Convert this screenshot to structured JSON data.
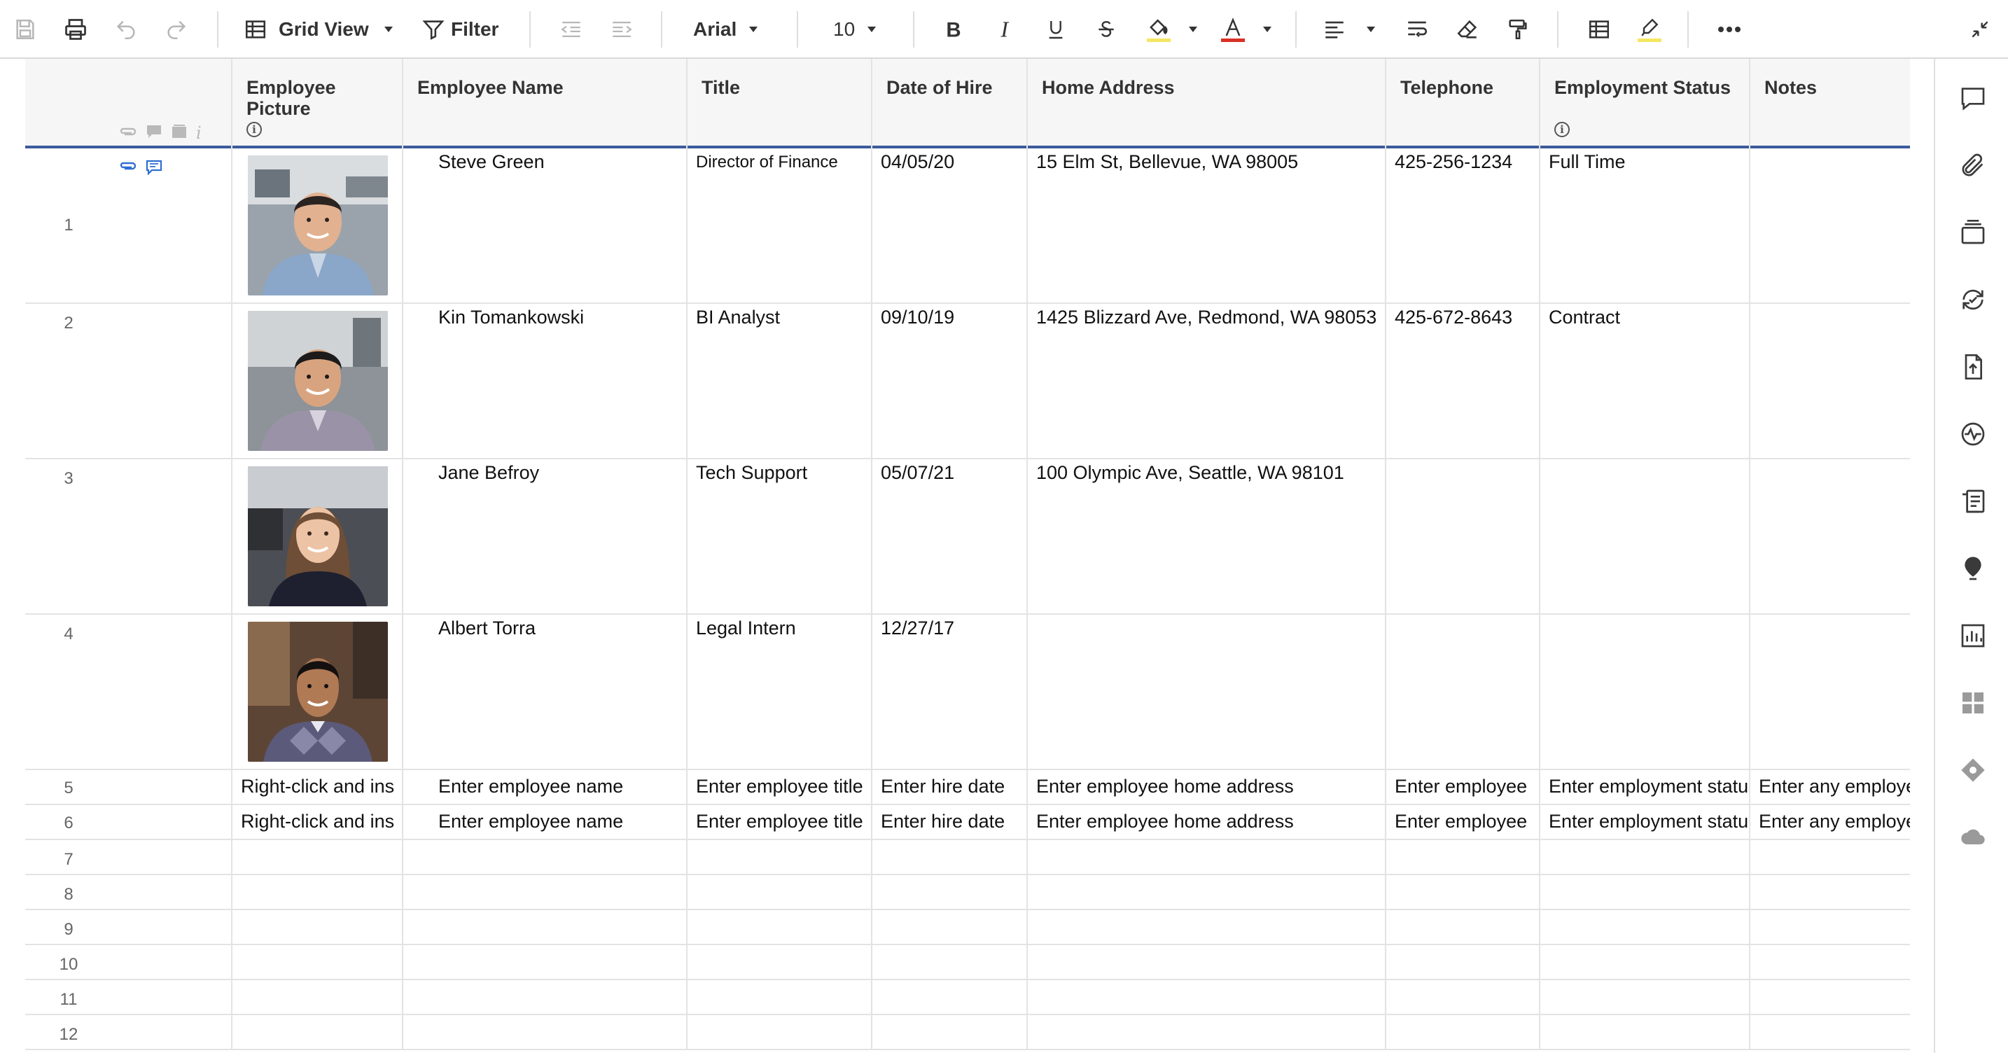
{
  "toolbar": {
    "view_label": "Grid View",
    "filter_label": "Filter",
    "font_family": "Arial",
    "font_size": "10"
  },
  "columns": [
    {
      "label": "Employee Picture"
    },
    {
      "label": "Employee Name"
    },
    {
      "label": "Title"
    },
    {
      "label": "Date of Hire"
    },
    {
      "label": "Home Address"
    },
    {
      "label": "Telephone"
    },
    {
      "label": "Employment Status"
    },
    {
      "label": "Notes"
    }
  ],
  "rows": [
    {
      "num": "1",
      "picture": "person-photo",
      "name": "Steve Green",
      "title": "Director of Finance",
      "hire": "04/05/20",
      "address": "15 Elm St, Bellevue, WA 98005",
      "phone": "425-256-1234",
      "status": "Full Time",
      "notes": ""
    },
    {
      "num": "2",
      "picture": "person-photo",
      "name": "Kin Tomankowski",
      "title": "BI Analyst",
      "hire": "09/10/19",
      "address": "1425 Blizzard Ave, Redmond, WA 98053",
      "phone": "425-672-8643",
      "status": "Contract",
      "notes": ""
    },
    {
      "num": "3",
      "picture": "person-photo",
      "name": "Jane Befroy",
      "title": "Tech Support",
      "hire": "05/07/21",
      "address": "100 Olympic Ave, Seattle, WA 98101",
      "phone": "",
      "status": "",
      "notes": ""
    },
    {
      "num": "4",
      "picture": "person-photo",
      "name": "Albert Torra",
      "title": "Legal Intern",
      "hire": "12/27/17",
      "address": "",
      "phone": "",
      "status": "",
      "notes": ""
    }
  ],
  "placeholder_rows": [
    {
      "num": "5",
      "picture": "Right-click and ins",
      "name": "Enter employee name",
      "title": "Enter employee title",
      "hire": "Enter hire date",
      "address": "Enter employee home address",
      "phone": "Enter employee",
      "status": "Enter employment statu",
      "notes": "Enter any employe"
    },
    {
      "num": "6",
      "picture": "Right-click and ins",
      "name": "Enter employee name",
      "title": "Enter employee title",
      "hire": "Enter hire date",
      "address": "Enter employee home address",
      "phone": "Enter employee",
      "status": "Enter employment statu",
      "notes": "Enter any employe"
    }
  ],
  "empty_rows": [
    "7",
    "8",
    "9",
    "10",
    "11",
    "12"
  ],
  "colors": {
    "header_bg": "#f6f6f6",
    "header_underline": "#3b5b9c",
    "fill_color_accent": "#f5e663",
    "text_color_accent": "#d93025",
    "highlight_accent": "#f5e663",
    "attachment_blue": "#2f6fd1"
  }
}
